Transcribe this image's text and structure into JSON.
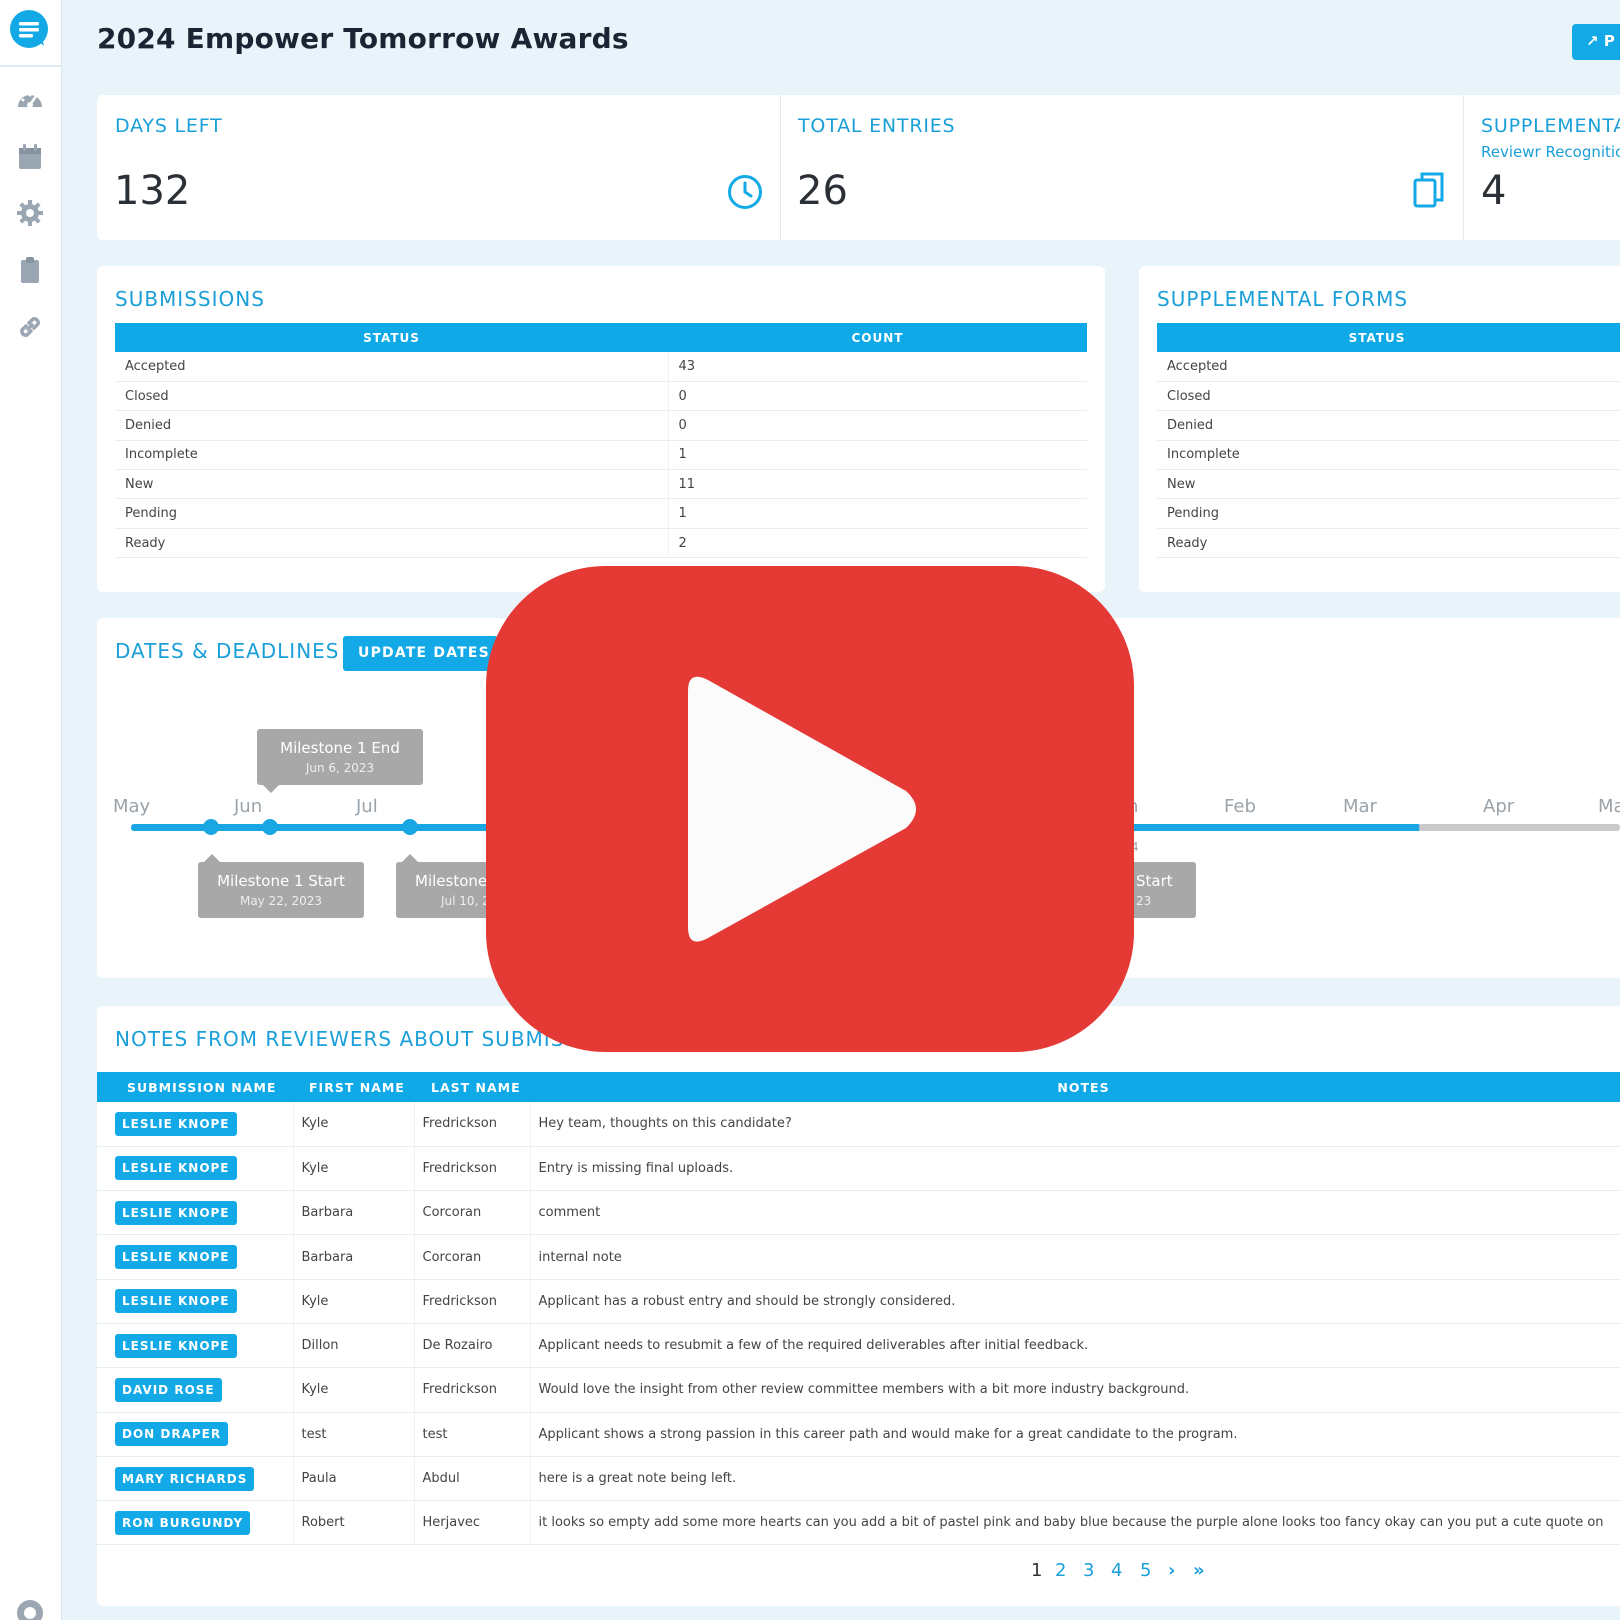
{
  "header": {
    "title": "2024 Empower Tomorrow Awards",
    "action_label": "P"
  },
  "sidebar": {
    "icons": [
      "logo-chat-icon",
      "dashboard-gauge-icon",
      "calendar-icon",
      "gear-icon",
      "clipboard-icon",
      "link-icon",
      "help-icon"
    ]
  },
  "stats": {
    "days_left": {
      "label": "DAYS LEFT",
      "value": "132",
      "icon": "clock-icon"
    },
    "total_entries": {
      "label": "TOTAL ENTRIES",
      "value": "26",
      "icon": "copy-icon"
    },
    "supplemental": {
      "label": "SUPPLEMENTA",
      "sub": "Reviewr Recognitio",
      "value": "4"
    }
  },
  "submissions": {
    "title": "SUBMISSIONS",
    "columns": [
      "STATUS",
      "COUNT"
    ],
    "rows": [
      [
        "Accepted",
        "43"
      ],
      [
        "Closed",
        "0"
      ],
      [
        "Denied",
        "0"
      ],
      [
        "Incomplete",
        "1"
      ],
      [
        "New",
        "11"
      ],
      [
        "Pending",
        "1"
      ],
      [
        "Ready",
        "2"
      ]
    ]
  },
  "supplemental_forms": {
    "title": "SUPPLEMENTAL FORMS",
    "columns": [
      "STATUS"
    ],
    "rows": [
      "Accepted",
      "Closed",
      "Denied",
      "Incomplete",
      "New",
      "Pending",
      "Ready"
    ]
  },
  "dates": {
    "title": "DATES & DEADLINES",
    "button": "UPDATE DATES",
    "months": [
      "May",
      "Jun",
      "Jul",
      "Feb",
      "Mar",
      "Apr",
      "Ma"
    ],
    "milestones_above": [
      {
        "title": "Milestone 1 End",
        "date": "Jun 6, 2023"
      }
    ],
    "milestones_below": [
      {
        "title": "Milestone 1 Start",
        "date": "May 22, 2023"
      },
      {
        "title": "Milestone",
        "date": "Jul 10, 2"
      },
      {
        "title": "Start",
        "date": "23"
      }
    ],
    "partial_marker": "4",
    "partial_month": "n"
  },
  "notes": {
    "title": "NOTES FROM REVIEWERS ABOUT SUBMISS",
    "columns": [
      "SUBMISSION NAME",
      "FIRST NAME",
      "LAST NAME",
      "NOTES"
    ],
    "rows": [
      {
        "submission": "LESLIE KNOPE",
        "first": "Kyle",
        "last": "Fredrickson",
        "note": "Hey team, thoughts on this candidate?"
      },
      {
        "submission": "LESLIE KNOPE",
        "first": "Kyle",
        "last": "Fredrickson",
        "note": "Entry is missing final uploads."
      },
      {
        "submission": "LESLIE KNOPE",
        "first": "Barbara",
        "last": "Corcoran",
        "note": "comment"
      },
      {
        "submission": "LESLIE KNOPE",
        "first": "Barbara",
        "last": "Corcoran",
        "note": "internal note"
      },
      {
        "submission": "LESLIE KNOPE",
        "first": "Kyle",
        "last": "Fredrickson",
        "note": "Applicant has a robust entry and should be strongly considered."
      },
      {
        "submission": "LESLIE KNOPE",
        "first": "Dillon",
        "last": "De Rozairo",
        "note": "Applicant needs to resubmit a few of the required deliverables after initial feedback."
      },
      {
        "submission": "DAVID ROSE",
        "first": "Kyle",
        "last": "Fredrickson",
        "note": "Would love the insight from other review committee members with a bit more industry background."
      },
      {
        "submission": "DON DRAPER",
        "first": "test",
        "last": "test",
        "note": "Applicant shows a strong passion in this career path and would make for a great candidate to the program."
      },
      {
        "submission": "MARY RICHARDS",
        "first": "Paula",
        "last": "Abdul",
        "note": "here is a great note being left."
      },
      {
        "submission": "RON BURGUNDY",
        "first": "Robert",
        "last": "Herjavec",
        "note": "it looks so empty add some more hearts can you add a bit of pastel pink and baby blue because the purple alone looks too fancy okay can you put a cute quote on"
      }
    ]
  },
  "pagination": {
    "pages": [
      "1",
      "2",
      "3",
      "4",
      "5"
    ],
    "next": "›",
    "last": "»"
  },
  "overlay": {
    "icon": "youtube-play-icon"
  },
  "colors": {
    "accent": "#13a9e6",
    "title_blue": "#1a9fd8",
    "page_bg": "#e9f3fa",
    "youtube_red": "#e53935",
    "tooltip_gray": "#a8a8a8"
  }
}
